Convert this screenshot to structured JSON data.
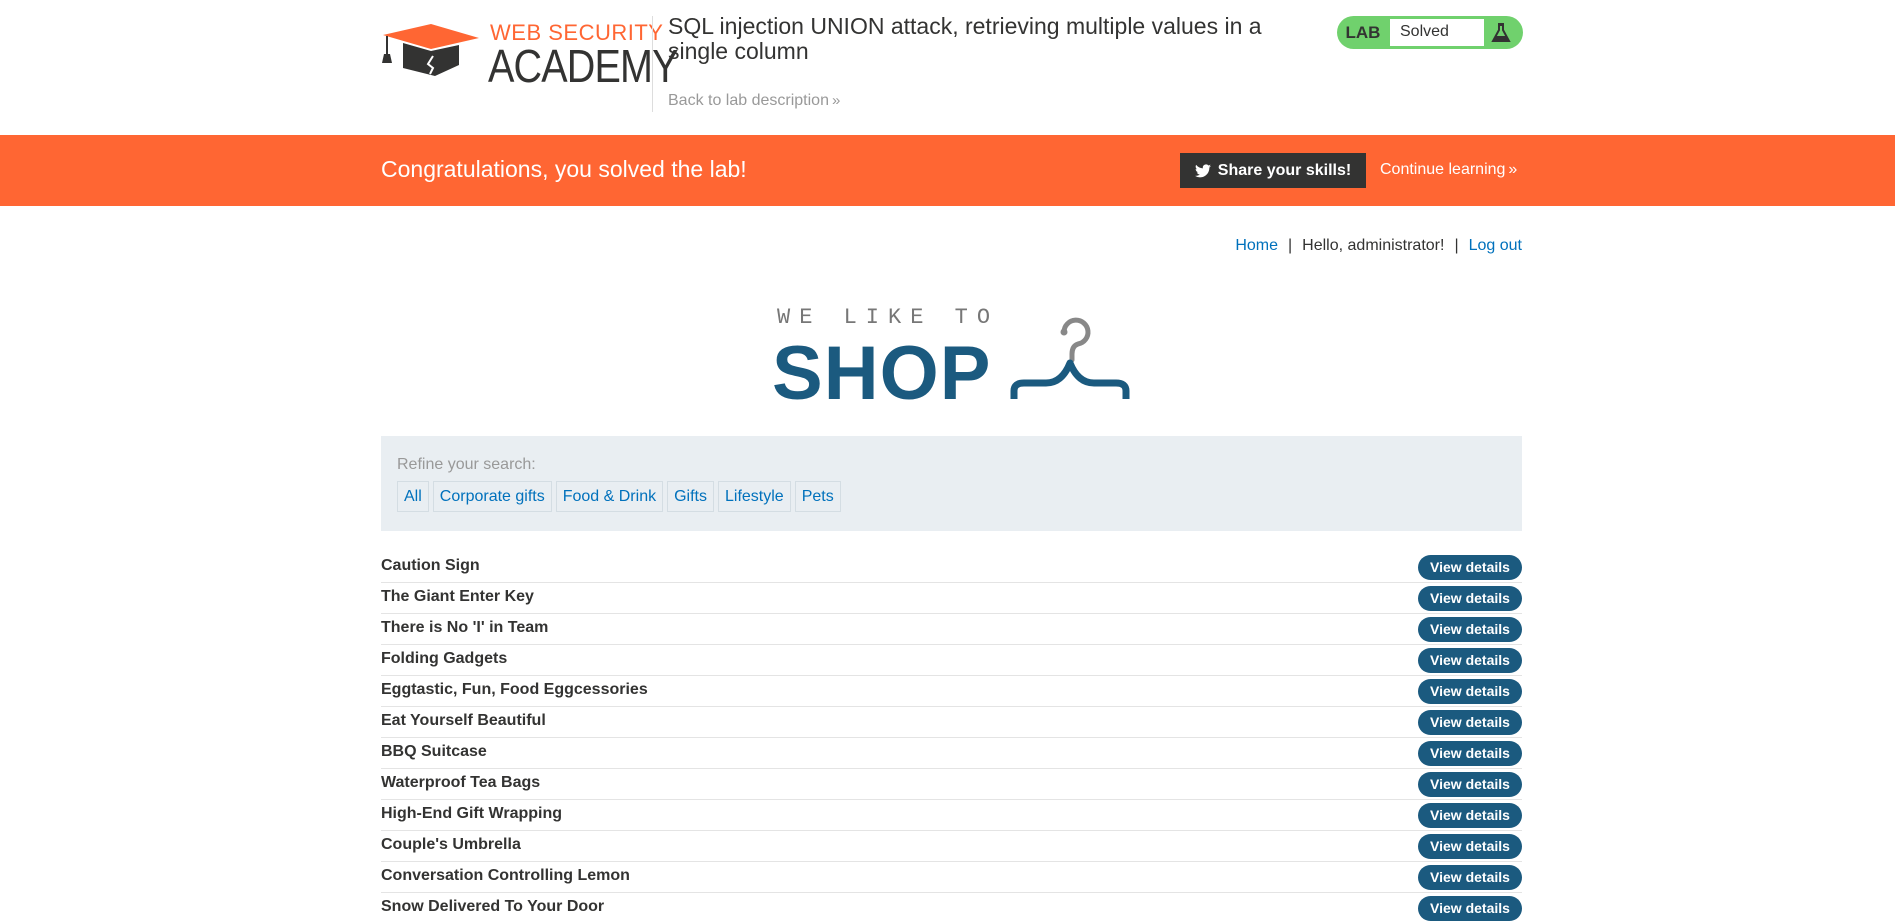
{
  "academy": {
    "logo_top": "WEB SECURITY",
    "logo_main": "ACADEMY",
    "lab_title": "SQL injection UNION attack, retrieving multiple values in a single column",
    "back_link": "Back to lab description",
    "lab_badge": "LAB",
    "lab_status": "Solved"
  },
  "banner": {
    "message": "Congratulations, you solved the lab!",
    "share_label": "Share your skills!",
    "continue_label": "Continue learning"
  },
  "nav": {
    "home": "Home",
    "separator": "|",
    "greeting": "Hello, administrator!",
    "logout": "Log out"
  },
  "shop_logo": {
    "tagline": "WE LIKE TO",
    "word": "SHOP"
  },
  "filter": {
    "label": "Refine your search:",
    "categories": [
      "All",
      "Corporate gifts",
      "Food & Drink",
      "Gifts",
      "Lifestyle",
      "Pets"
    ]
  },
  "products": [
    {
      "name": "Caution Sign",
      "action": "View details"
    },
    {
      "name": "The Giant Enter Key",
      "action": "View details"
    },
    {
      "name": "There is No 'I' in Team",
      "action": "View details"
    },
    {
      "name": "Folding Gadgets",
      "action": "View details"
    },
    {
      "name": "Eggtastic, Fun, Food Eggcessories",
      "action": "View details"
    },
    {
      "name": "Eat Yourself Beautiful",
      "action": "View details"
    },
    {
      "name": "BBQ Suitcase",
      "action": "View details"
    },
    {
      "name": "Waterproof Tea Bags",
      "action": "View details"
    },
    {
      "name": "High-End Gift Wrapping",
      "action": "View details"
    },
    {
      "name": "Couple's Umbrella",
      "action": "View details"
    },
    {
      "name": "Conversation Controlling Lemon",
      "action": "View details"
    },
    {
      "name": "Snow Delivered To Your Door",
      "action": "View details"
    }
  ],
  "colors": {
    "brand_orange": "#ff6633",
    "shop_blue": "#1b5a7f",
    "link_blue": "#0071bc",
    "solved_green": "#70d16d",
    "filter_bg": "#e9eef2"
  },
  "icons": {
    "logo": "graduation-cap-icon",
    "flask": "flask-icon",
    "twitter": "twitter-bird-icon",
    "chevron": "double-chevron-right-icon",
    "hanger": "clothes-hanger-icon"
  }
}
